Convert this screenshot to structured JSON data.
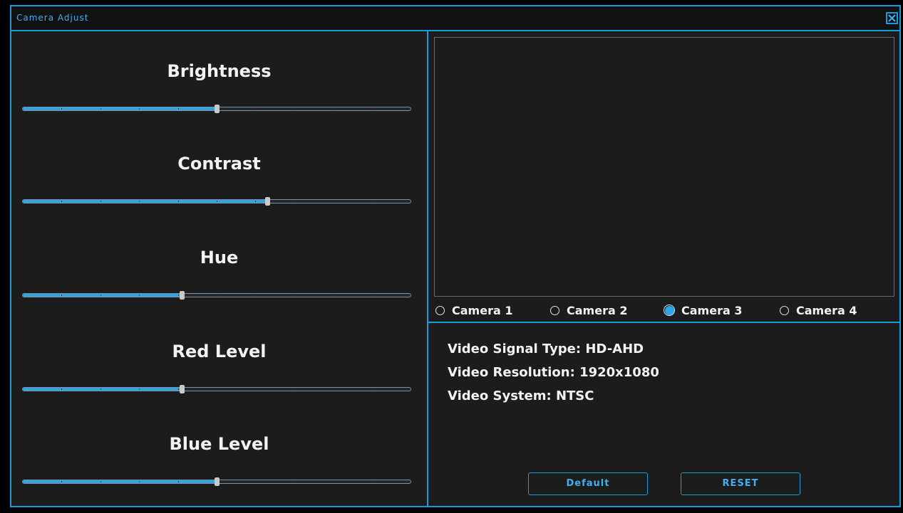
{
  "window": {
    "title": "Camera Adjust"
  },
  "sliders": [
    {
      "label": "Brightness",
      "value_fraction": 0.5
    },
    {
      "label": "Contrast",
      "value_fraction": 0.63
    },
    {
      "label": "Hue",
      "value_fraction": 0.41
    },
    {
      "label": "Red Level",
      "value_fraction": 0.41
    },
    {
      "label": "Blue Level",
      "value_fraction": 0.5
    }
  ],
  "cameras": [
    {
      "label": "Camera 1",
      "selected": false
    },
    {
      "label": "Camera 2",
      "selected": false
    },
    {
      "label": "Camera 3",
      "selected": true
    },
    {
      "label": "Camera 4",
      "selected": false
    }
  ],
  "info": {
    "signal_type": "Video Signal Type: HD-AHD",
    "resolution": "Video Resolution: 1920x1080",
    "system": "Video System: NTSC"
  },
  "buttons": {
    "default_label": "Default",
    "reset_label": "RESET"
  },
  "colors": {
    "accent": "#1a9be0",
    "fill": "#2aa6ec",
    "background": "#1c1c1c"
  }
}
